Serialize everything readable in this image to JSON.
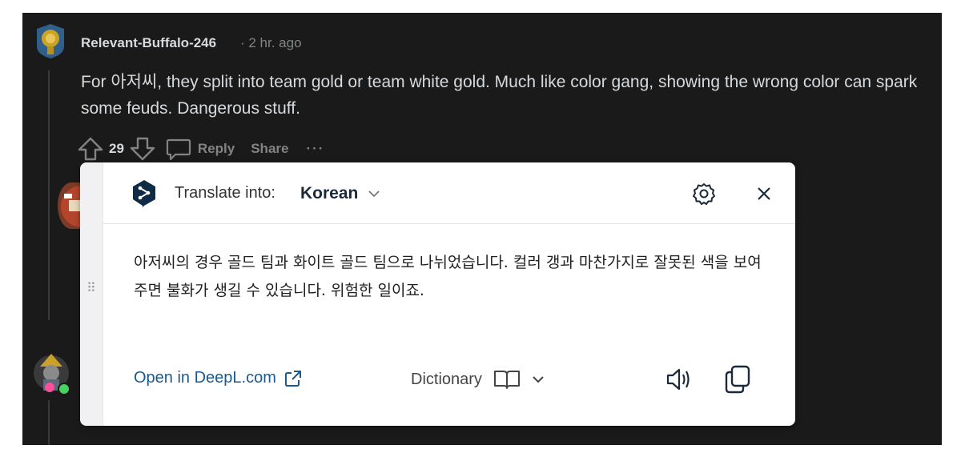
{
  "comment": {
    "username": "Relevant-Buffalo-246",
    "time": "· 2 hr. ago",
    "body": "For 아저씨, they split into team gold or team white gold. Much like color gang, showing the wrong color can spark some feuds. Dangerous stuff.",
    "vote_count": "29",
    "reply_label": "Reply",
    "share_label": "Share",
    "more_label": "···"
  },
  "popup": {
    "translate_label": "Translate into:",
    "target_language": "Korean",
    "translation": "아저씨의 경우 골드 팀과 화이트 골드 팀으로 나뉘었습니다. 컬러 갱과 마찬가지로 잘못된 색을 보여주면 불화가 생길 수 있습니다. 위험한 일이죠.",
    "open_link": "Open in DeepL.com",
    "dictionary_label": "Dictionary",
    "drag_handle": "⠿"
  },
  "colors": {
    "background": "#1a1a1b",
    "comment_text": "#d7dadc",
    "meta_text": "#818384",
    "link_blue": "#1a5a8f",
    "deepl_navy": "#0f2b46"
  }
}
